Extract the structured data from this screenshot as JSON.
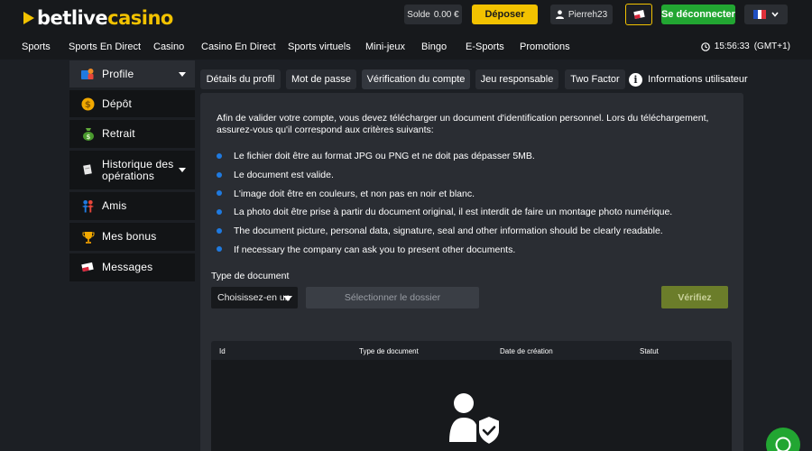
{
  "header": {
    "logo_white": "betlive",
    "logo_yellow": "casino",
    "balance_label": "Solde",
    "balance_value": "0.00 €",
    "deposit_label": "Déposer",
    "username": "Pierreh23",
    "logout_label": "Se déconnecter",
    "colors": {
      "accent": "#f2c200",
      "success": "#22a632",
      "info": "#1f7ae0"
    }
  },
  "nav": {
    "items": [
      "Sports",
      "Sports En Direct",
      "Casino",
      "Casino En Direct",
      "Sports virtuels",
      "Mini-jeux",
      "Bingo",
      "E-Sports",
      "Promotions"
    ],
    "time": "15:56:33",
    "timezone": "(GMT+1)"
  },
  "sidebar": {
    "items": [
      {
        "label": "Profile",
        "icon": "profile-icon"
      },
      {
        "label": "Dépôt",
        "icon": "coin-icon"
      },
      {
        "label": "Retrait",
        "icon": "money-bag-icon"
      },
      {
        "label": "Historique des opérations",
        "icon": "receipt-icon"
      },
      {
        "label": "Amis",
        "icon": "friends-icon"
      },
      {
        "label": "Mes bonus",
        "icon": "trophy-icon"
      },
      {
        "label": "Messages",
        "icon": "envelope-icon"
      }
    ]
  },
  "tabs": {
    "items": [
      "Détails du profil",
      "Mot de passe",
      "Vérification du compte",
      "Jeu responsable",
      "Two Factor"
    ],
    "info_label": "Informations utilisateur"
  },
  "verification": {
    "intro": "Afin de valider votre compte, vous devez télécharger un document d'identification personnel. Lors du téléchargement, assurez-vous qu'il correspond aux critères suivants:",
    "rules": [
      "Le fichier doit être au format JPG ou PNG et ne doit pas dépasser 5MB.",
      "Le document est valide.",
      "L'image doit être en couleurs, et non pas en noir et blanc.",
      "La photo doit être prise à partir du document original, il est interdit de faire un montage photo numérique.",
      "The document picture, personal data, signature, seal and other information should be clearly readable.",
      "If necessary the company can ask you to present other documents."
    ],
    "doc_type_label": "Type de document",
    "doc_select_value": "Choisissez-en un",
    "select_folder_label": "Sélectionner le dossier",
    "verify_label": "Vérifiez",
    "table_columns": [
      "Id",
      "Type de document",
      "Date de création",
      "Statut"
    ]
  }
}
